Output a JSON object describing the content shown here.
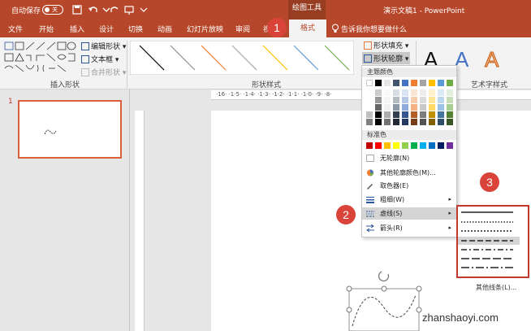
{
  "titlebar": {
    "autosave": "自动保存",
    "toggle": "关",
    "tool_tab": "绘图工具",
    "doc_title": "演示文稿1 - PowerPoint"
  },
  "tabs": [
    "文件",
    "开始",
    "插入",
    "设计",
    "切换",
    "动画",
    "幻灯片放映",
    "审阅",
    "视图"
  ],
  "active_tab": "格式",
  "tell_me": "告诉我你想要做什么",
  "ribbon": {
    "insert_shapes": {
      "edit_shape": "编辑形状",
      "text_box": "文本框",
      "merge_shapes": "合并形状",
      "label": "插入形状"
    },
    "shape_styles": {
      "label": "形状样式",
      "fill": "形状填充",
      "outline": "形状轮廓"
    },
    "wordart": {
      "letter": "A",
      "label": "艺术字样式"
    }
  },
  "slide_number": "1",
  "hruler_text": "·16· ·1·5· ·1·4· ·1·3· ·1·2· ·1·1· ·1·0· ·9· ·8·",
  "menu": {
    "theme_colors": "主题颜色",
    "standard_colors": "标准色",
    "no_outline": "无轮廓(N)",
    "more_colors": "其他轮廓颜色(M)...",
    "eyedropper": "取色器(E)",
    "weight": "粗细(W)",
    "dashes": "虚线(S)",
    "arrows": "箭头(R)"
  },
  "theme_row1": [
    "#ffffff",
    "#000000",
    "#e7e6e6",
    "#44546a",
    "#4472c4",
    "#ed7d31",
    "#a5a5a5",
    "#ffc000",
    "#5b9bd5",
    "#70ad47"
  ],
  "standard_colors": [
    "#c00000",
    "#ff0000",
    "#ffc000",
    "#ffff00",
    "#92d050",
    "#00b050",
    "#00b0f0",
    "#0070c0",
    "#002060",
    "#7030a0"
  ],
  "submenu": {
    "more_lines": "其他线条(L)..."
  },
  "badges": [
    "1",
    "2",
    "3"
  ],
  "watermark": "zhanshaoyi.com",
  "colors": {
    "accent": "#b7472a",
    "badge": "#d9433a"
  }
}
